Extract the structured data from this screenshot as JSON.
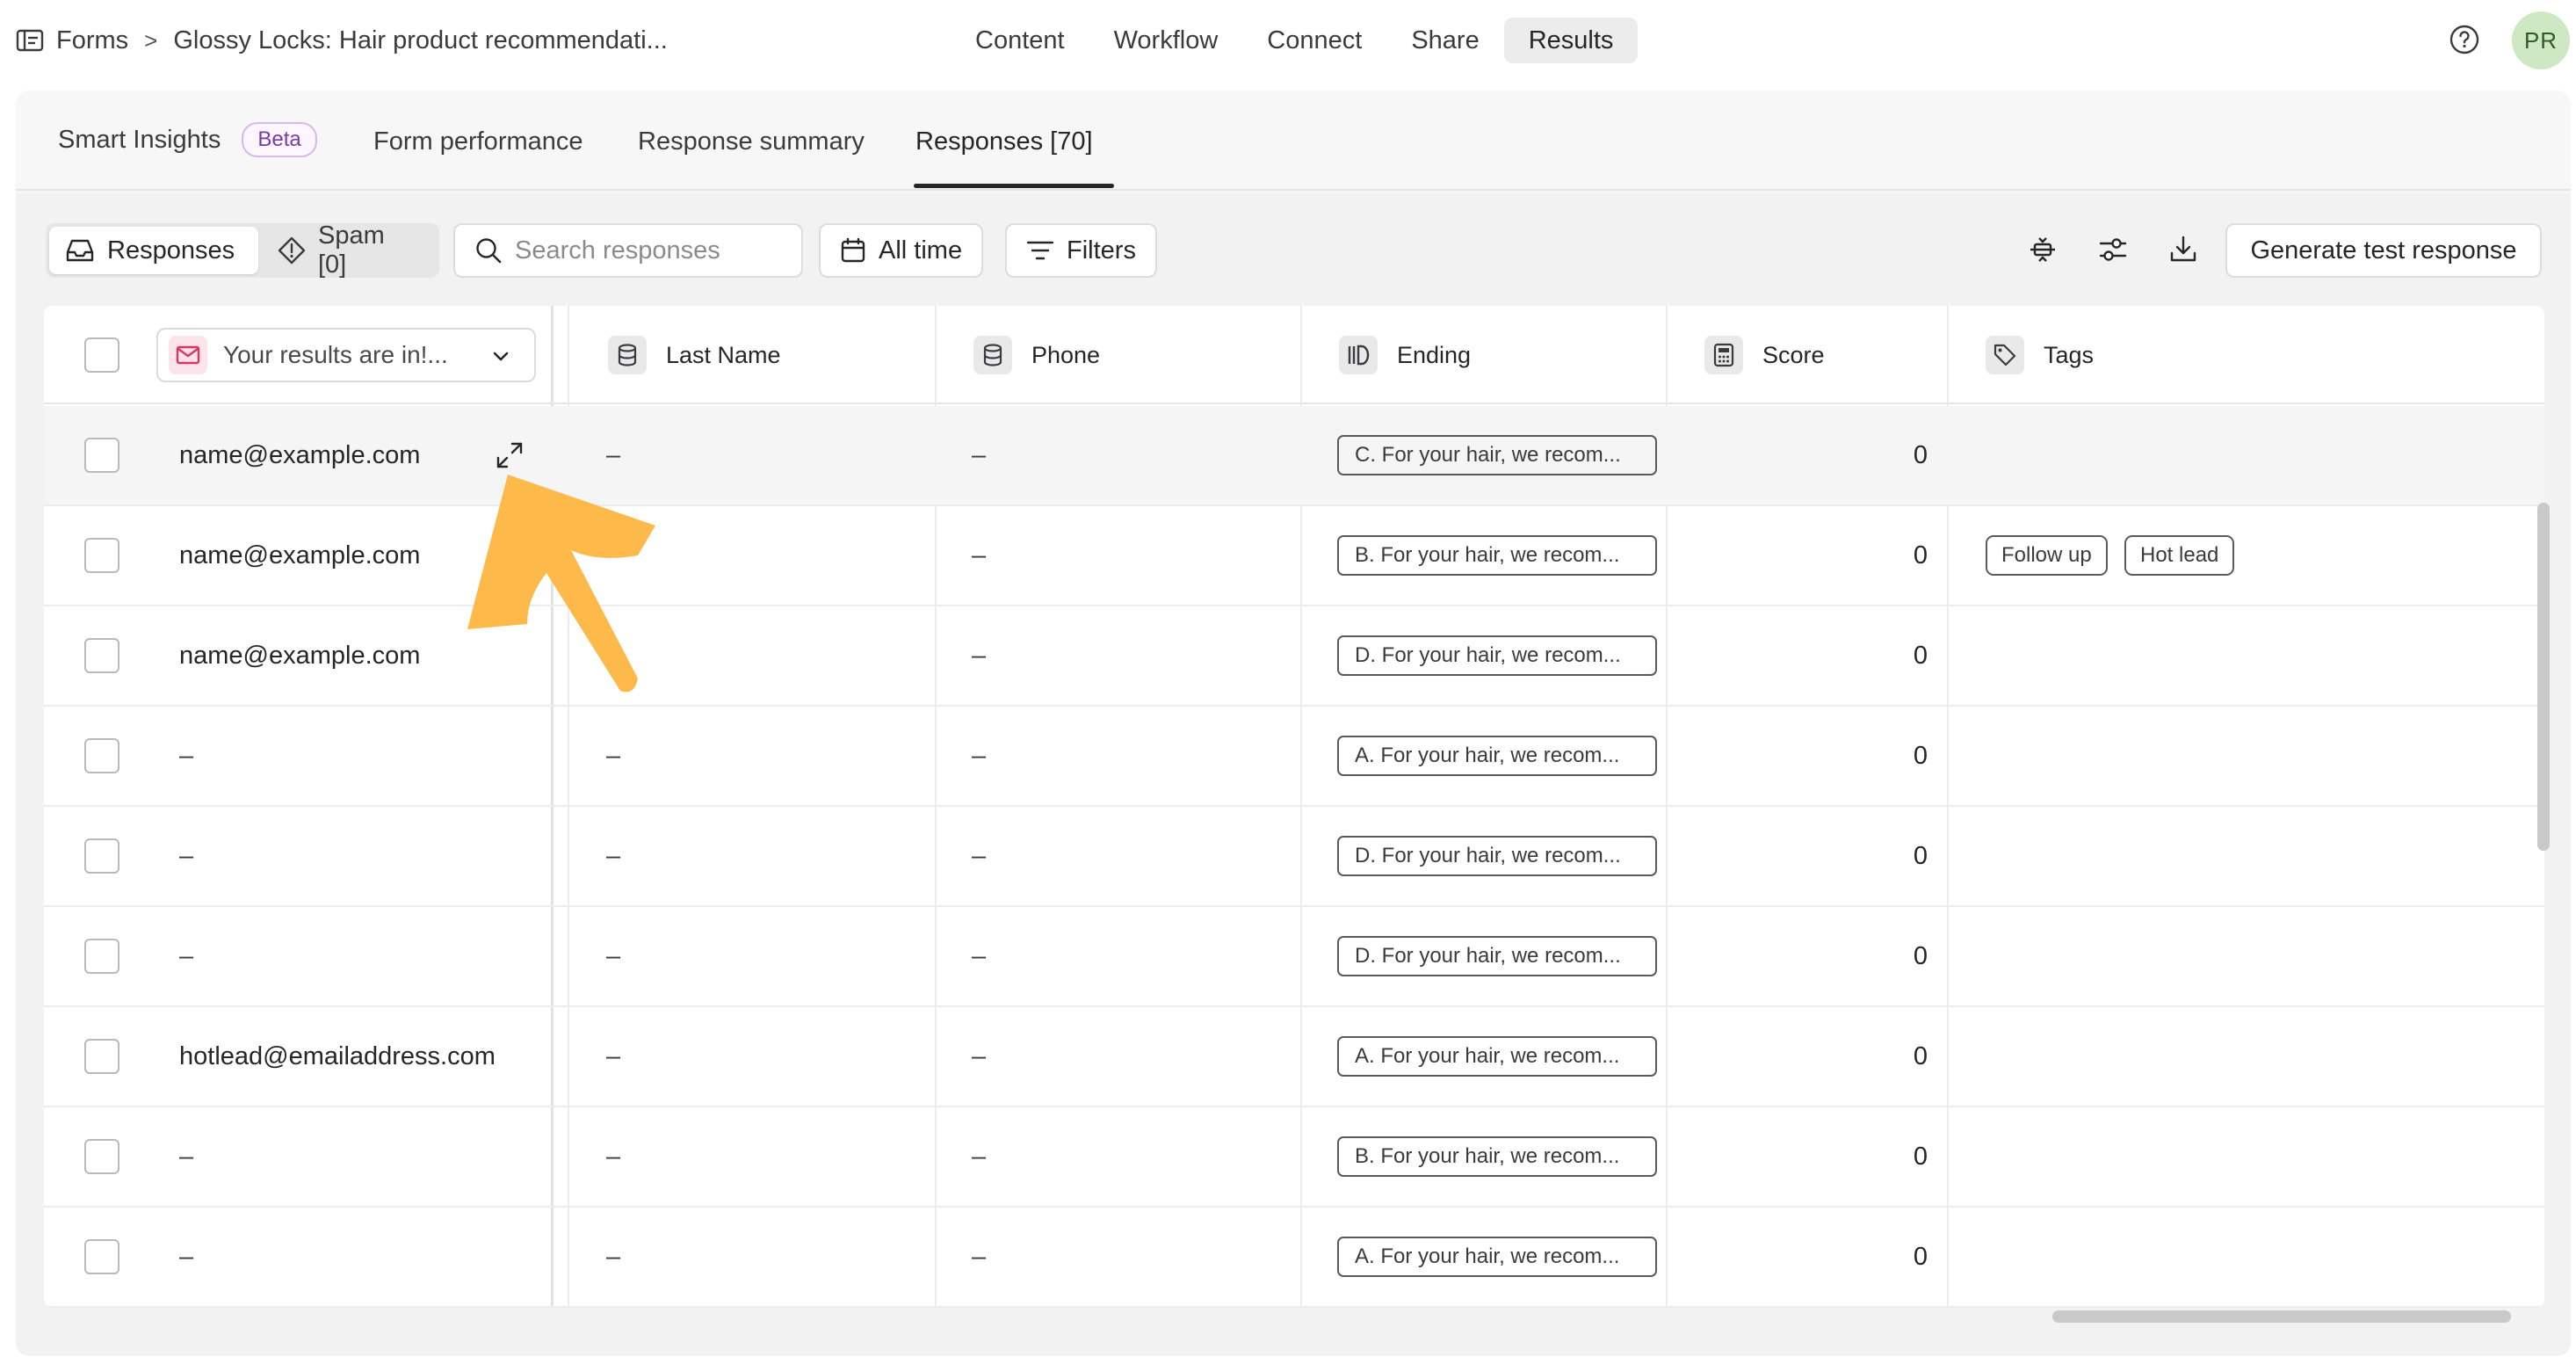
{
  "breadcrumb": {
    "root": "Forms",
    "separator": ">",
    "form_title": "Glossy Locks: Hair product recommendati..."
  },
  "top_nav": [
    "Content",
    "Workflow",
    "Connect",
    "Share",
    "Results"
  ],
  "top_nav_active": "Results",
  "user": {
    "initials": "PR"
  },
  "tabs": {
    "smart_insights": "Smart Insights",
    "beta_badge": "Beta",
    "form_performance": "Form performance",
    "response_summary": "Response summary",
    "responses": "Responses [70]"
  },
  "toolbar": {
    "responses_label": "Responses",
    "spam_label": "Spam [0]",
    "search_placeholder": "Search responses",
    "date_filter": "All time",
    "filters_label": "Filters",
    "generate_label": "Generate test response"
  },
  "columns": {
    "email_question": "Your results are in!...",
    "last_name": "Last Name",
    "phone": "Phone",
    "ending": "Ending",
    "score": "Score",
    "tags": "Tags"
  },
  "rows": [
    {
      "email": "name@example.com",
      "last_name": "–",
      "phone": "–",
      "ending": "C. For your hair, we recom...",
      "score": "0",
      "tags": []
    },
    {
      "email": "name@example.com",
      "last_name": "–",
      "phone": "–",
      "ending": "B. For your hair, we recom...",
      "score": "0",
      "tags": [
        "Follow up",
        "Hot lead"
      ]
    },
    {
      "email": "name@example.com",
      "last_name": "–",
      "phone": "–",
      "ending": "D. For your hair, we recom...",
      "score": "0",
      "tags": []
    },
    {
      "email": "–",
      "last_name": "–",
      "phone": "–",
      "ending": "A. For your hair, we recom...",
      "score": "0",
      "tags": []
    },
    {
      "email": "–",
      "last_name": "–",
      "phone": "–",
      "ending": "D. For your hair, we recom...",
      "score": "0",
      "tags": []
    },
    {
      "email": "–",
      "last_name": "–",
      "phone": "–",
      "ending": "D. For your hair, we recom...",
      "score": "0",
      "tags": []
    },
    {
      "email": "hotlead@emailaddress.com",
      "last_name": "–",
      "phone": "–",
      "ending": "A. For your hair, we recom...",
      "score": "0",
      "tags": []
    },
    {
      "email": "–",
      "last_name": "–",
      "phone": "–",
      "ending": "B. For your hair, we recom...",
      "score": "0",
      "tags": []
    },
    {
      "email": "–",
      "last_name": "–",
      "phone": "–",
      "ending": "A. For your hair, we recom...",
      "score": "0",
      "tags": []
    }
  ],
  "colors": {
    "annotation_arrow": "#FDBA4A",
    "avatar_bg": "#CFE8C4",
    "beta_border": "#D6B8EF",
    "email_icon_bg": "#FDE3EA"
  }
}
